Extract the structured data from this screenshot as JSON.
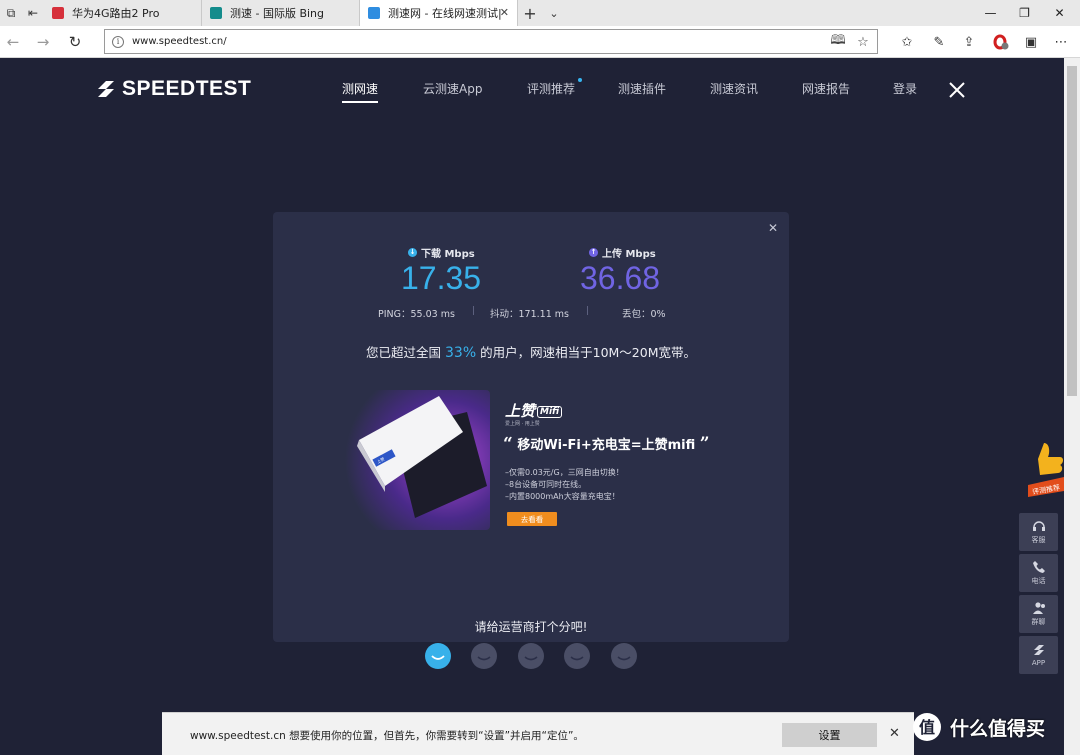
{
  "browser": {
    "tabs": [
      {
        "label": "华为4G路由2 Pro",
        "favicon_color": "#d6303b"
      },
      {
        "label": "测速 - 国际版 Bing",
        "favicon_color": "#148c8c"
      },
      {
        "label": "测速网 - 在线网速测试|",
        "favicon_color": "#2f8de0",
        "active": true
      }
    ],
    "url": "www.speedtest.cn/"
  },
  "site": {
    "logo_text": "SPEEDTEST",
    "nav": [
      "测网速",
      "云测速App",
      "评测推荐",
      "测速插件",
      "测速资讯",
      "网速报告",
      "登录"
    ]
  },
  "result": {
    "download_label": "下载 Mbps",
    "download_value": "17.35",
    "upload_label": "上传 Mbps",
    "upload_value": "36.68",
    "ping_label": "PING：",
    "ping_value": "55.03 ms",
    "jitter_label": "抖动：",
    "jitter_value": "171.11 ms",
    "loss_label": "丢包：",
    "loss_value": "0%",
    "sep": "|",
    "summary_prefix": "您已超过全国",
    "summary_pct": "33%",
    "summary_suffix": "的用户，网速相当于10M～20M宽带。"
  },
  "ad": {
    "brand": "上赞",
    "brand_tag": "Mifi",
    "brand_sub": "爱上网 · 用上赞",
    "tv_label": "上赞",
    "title": "移动Wi-Fi+充电宝=上赞mifi",
    "lines": [
      "–仅需0.03元/G，三网自由切换！",
      "–8台设备可同时在线。",
      "–内置8000mAh大容量充电宝！"
    ],
    "button": "去看看"
  },
  "rating": {
    "title": "请给运营商打个分吧!",
    "faces": 5,
    "selected": 1,
    "selected_color": "#38b1ea",
    "idle_color": "#4a4e66"
  },
  "side": {
    "ribbon": "评测推荐",
    "buttons": [
      {
        "label": "客服",
        "icon": "headset-icon"
      },
      {
        "label": "电话",
        "icon": "phone-icon"
      },
      {
        "label": "群聊",
        "icon": "group-icon"
      },
      {
        "label": "APP",
        "icon": "app-icon"
      }
    ]
  },
  "prompt": {
    "message": "www.speedtest.cn 想要使用你的位置，但首先，你需要转到“设置”并启用“定位”。",
    "button": "设置"
  },
  "watermark": {
    "text": "什么值得买",
    "icon_char": "值"
  },
  "colors": {
    "page_bg": "#1f2236",
    "card_bg": "#2b2f48",
    "download": "#38b1ea",
    "upload": "#7064e3",
    "ad_button": "#f08d1e"
  }
}
